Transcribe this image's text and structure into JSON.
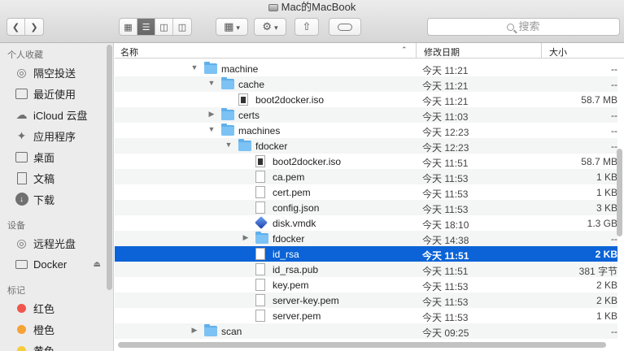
{
  "window": {
    "title": "Mac的MacBook"
  },
  "toolbar": {
    "back_icon": "chevron-left-icon",
    "forward_icon": "chevron-right-icon",
    "view_modes": [
      "icon-view",
      "list-view",
      "column-view",
      "cover-flow-view"
    ],
    "active_view": "list-view",
    "arrange_icon": "arrange-grid-icon",
    "action_icon": "gear-icon",
    "share_icon": "share-icon",
    "tag_icon": "tag-icon",
    "search_placeholder": "搜索"
  },
  "sidebar": {
    "sections": [
      {
        "header": "个人收藏",
        "items": [
          {
            "label": "隔空投送",
            "icon": "airdrop-icon"
          },
          {
            "label": "最近使用",
            "icon": "recents-icon"
          },
          {
            "label": "iCloud 云盘",
            "icon": "cloud-icon"
          },
          {
            "label": "应用程序",
            "icon": "applications-icon"
          },
          {
            "label": "桌面",
            "icon": "desktop-icon"
          },
          {
            "label": "文稿",
            "icon": "documents-icon"
          },
          {
            "label": "下载",
            "icon": "downloads-icon"
          }
        ]
      },
      {
        "header": "设备",
        "items": [
          {
            "label": "远程光盘",
            "icon": "disc-icon"
          },
          {
            "label": "Docker",
            "icon": "drive-icon",
            "eject": true
          }
        ]
      },
      {
        "header": "标记",
        "items": [
          {
            "label": "红色",
            "color": "#f0564d"
          },
          {
            "label": "橙色",
            "color": "#f6a336"
          },
          {
            "label": "黄色",
            "color": "#f6cd3a"
          }
        ]
      }
    ]
  },
  "columns": {
    "name": "名称",
    "date": "修改日期",
    "size": "大小"
  },
  "rows": [
    {
      "name": "machine",
      "type": "folder",
      "indent": 0,
      "disclosure": "open",
      "date": "今天 11:21",
      "size": "--"
    },
    {
      "name": "cache",
      "type": "folder",
      "indent": 1,
      "disclosure": "open",
      "date": "今天 11:21",
      "size": "--"
    },
    {
      "name": "boot2docker.iso",
      "type": "file-exec",
      "indent": 2,
      "disclosure": "none",
      "date": "今天 11:21",
      "size": "58.7 MB"
    },
    {
      "name": "certs",
      "type": "folder",
      "indent": 1,
      "disclosure": "closed",
      "date": "今天 11:03",
      "size": "--"
    },
    {
      "name": "machines",
      "type": "folder",
      "indent": 1,
      "disclosure": "open",
      "date": "今天 12:23",
      "size": "--"
    },
    {
      "name": "fdocker",
      "type": "folder",
      "indent": 2,
      "disclosure": "open",
      "date": "今天 12:23",
      "size": "--"
    },
    {
      "name": "boot2docker.iso",
      "type": "file-exec",
      "indent": 3,
      "disclosure": "none",
      "date": "今天 11:51",
      "size": "58.7 MB"
    },
    {
      "name": "ca.pem",
      "type": "file",
      "indent": 3,
      "disclosure": "none",
      "date": "今天 11:53",
      "size": "1 KB"
    },
    {
      "name": "cert.pem",
      "type": "file",
      "indent": 3,
      "disclosure": "none",
      "date": "今天 11:53",
      "size": "1 KB"
    },
    {
      "name": "config.json",
      "type": "file",
      "indent": 3,
      "disclosure": "none",
      "date": "今天 11:53",
      "size": "3 KB"
    },
    {
      "name": "disk.vmdk",
      "type": "vmdk",
      "indent": 3,
      "disclosure": "none",
      "date": "今天 18:10",
      "size": "1.3 GB"
    },
    {
      "name": "fdocker",
      "type": "folder",
      "indent": 3,
      "disclosure": "closed",
      "date": "今天 14:38",
      "size": "--"
    },
    {
      "name": "id_rsa",
      "type": "file",
      "indent": 3,
      "disclosure": "none",
      "date": "今天 11:51",
      "size": "2 KB",
      "selected": true
    },
    {
      "name": "id_rsa.pub",
      "type": "file",
      "indent": 3,
      "disclosure": "none",
      "date": "今天 11:51",
      "size": "381 字节"
    },
    {
      "name": "key.pem",
      "type": "file",
      "indent": 3,
      "disclosure": "none",
      "date": "今天 11:53",
      "size": "2 KB"
    },
    {
      "name": "server-key.pem",
      "type": "file",
      "indent": 3,
      "disclosure": "none",
      "date": "今天 11:53",
      "size": "2 KB"
    },
    {
      "name": "server.pem",
      "type": "file",
      "indent": 3,
      "disclosure": "none",
      "date": "今天 11:53",
      "size": "1 KB"
    },
    {
      "name": "scan",
      "type": "folder",
      "indent": 0,
      "disclosure": "closed",
      "date": "今天 09:25",
      "size": "--"
    }
  ]
}
